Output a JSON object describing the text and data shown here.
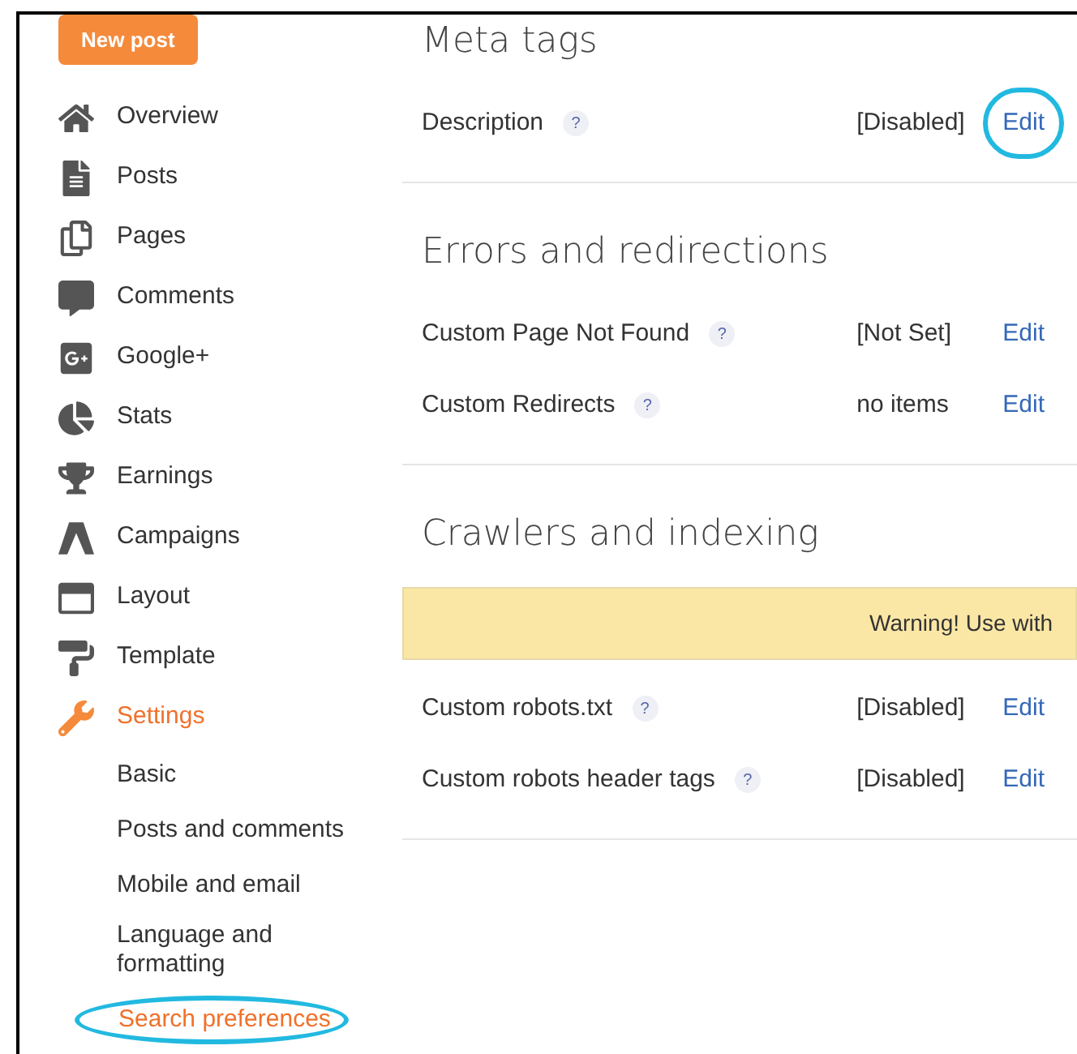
{
  "new_post_button": "New post",
  "sidebar": {
    "items": [
      {
        "label": "Overview",
        "selected": false
      },
      {
        "label": "Posts",
        "selected": false
      },
      {
        "label": "Pages",
        "selected": false
      },
      {
        "label": "Comments",
        "selected": false
      },
      {
        "label": "Google+",
        "selected": false
      },
      {
        "label": "Stats",
        "selected": false
      },
      {
        "label": "Earnings",
        "selected": false
      },
      {
        "label": "Campaigns",
        "selected": false
      },
      {
        "label": "Layout",
        "selected": false
      },
      {
        "label": "Template",
        "selected": false
      },
      {
        "label": "Settings",
        "selected": true,
        "children": [
          {
            "label": "Basic",
            "selected": false,
            "highlighted": false
          },
          {
            "label": "Posts and comments",
            "selected": false,
            "highlighted": false
          },
          {
            "label": "Mobile and email",
            "selected": false,
            "highlighted": false
          },
          {
            "label": "Language and formatting",
            "selected": false,
            "highlighted": false
          },
          {
            "label": "Search preferences",
            "selected": true,
            "highlighted": true
          }
        ]
      }
    ]
  },
  "sections": [
    {
      "title": "Meta tags",
      "rows": [
        {
          "label": "Description",
          "help": "?",
          "value": "[Disabled]",
          "action": "Edit",
          "highlighted": true
        }
      ]
    },
    {
      "title": "Errors and redirections",
      "rows": [
        {
          "label": "Custom Page Not Found",
          "help": "?",
          "value": "[Not Set]",
          "action": "Edit",
          "highlighted": false
        },
        {
          "label": "Custom Redirects",
          "help": "?",
          "value": "no items",
          "action": "Edit",
          "highlighted": false
        }
      ]
    },
    {
      "title": "Crawlers and indexing",
      "warning": "Warning! Use with",
      "rows": [
        {
          "label": "Custom robots.txt",
          "help": "?",
          "value": "[Disabled]",
          "action": "Edit",
          "highlighted": false
        },
        {
          "label": "Custom robots header tags",
          "help": "?",
          "value": "[Disabled]",
          "action": "Edit",
          "highlighted": false
        }
      ]
    }
  ]
}
